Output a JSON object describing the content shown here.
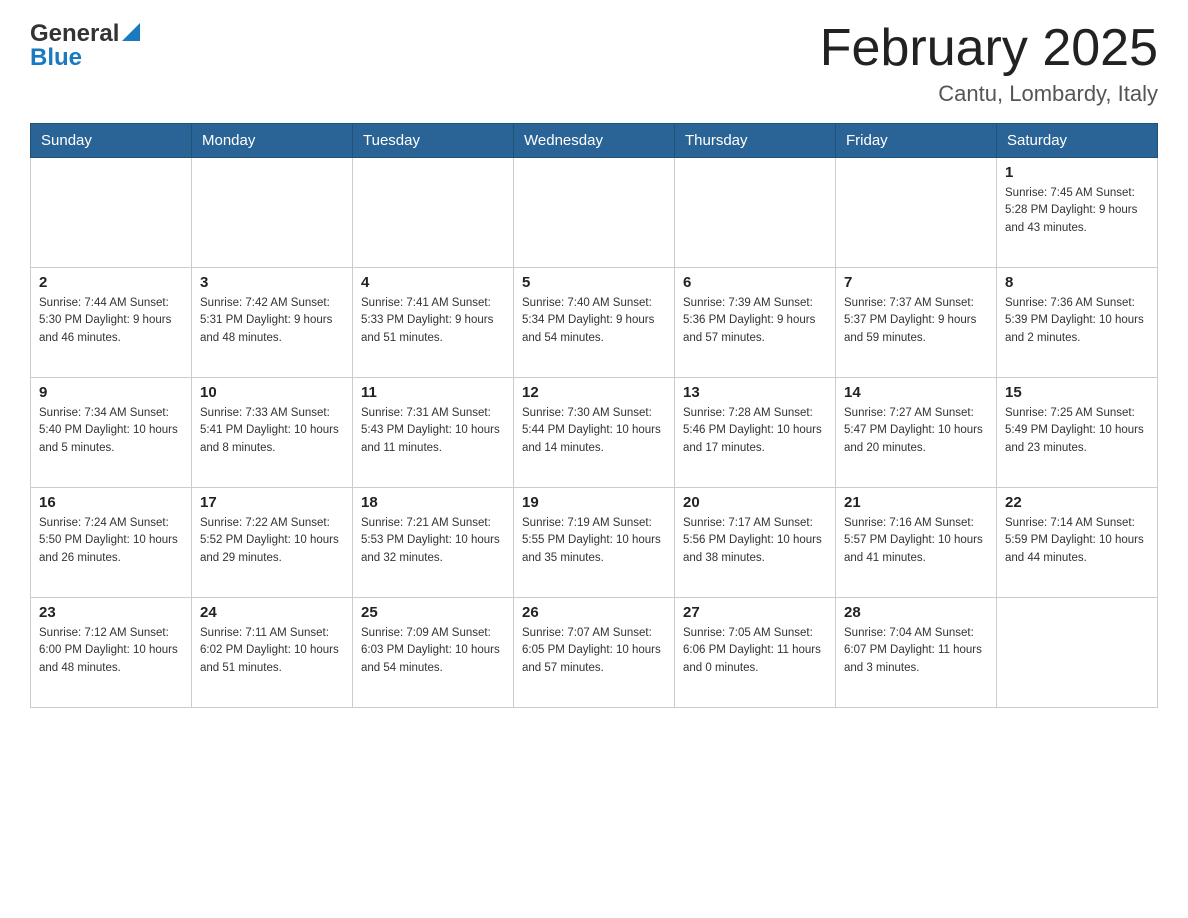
{
  "header": {
    "logo_general": "General",
    "logo_blue": "Blue",
    "month_title": "February 2025",
    "location": "Cantu, Lombardy, Italy"
  },
  "weekdays": [
    "Sunday",
    "Monday",
    "Tuesday",
    "Wednesday",
    "Thursday",
    "Friday",
    "Saturday"
  ],
  "weeks": [
    {
      "days": [
        {
          "num": "",
          "info": ""
        },
        {
          "num": "",
          "info": ""
        },
        {
          "num": "",
          "info": ""
        },
        {
          "num": "",
          "info": ""
        },
        {
          "num": "",
          "info": ""
        },
        {
          "num": "",
          "info": ""
        },
        {
          "num": "1",
          "info": "Sunrise: 7:45 AM\nSunset: 5:28 PM\nDaylight: 9 hours\nand 43 minutes."
        }
      ]
    },
    {
      "days": [
        {
          "num": "2",
          "info": "Sunrise: 7:44 AM\nSunset: 5:30 PM\nDaylight: 9 hours\nand 46 minutes."
        },
        {
          "num": "3",
          "info": "Sunrise: 7:42 AM\nSunset: 5:31 PM\nDaylight: 9 hours\nand 48 minutes."
        },
        {
          "num": "4",
          "info": "Sunrise: 7:41 AM\nSunset: 5:33 PM\nDaylight: 9 hours\nand 51 minutes."
        },
        {
          "num": "5",
          "info": "Sunrise: 7:40 AM\nSunset: 5:34 PM\nDaylight: 9 hours\nand 54 minutes."
        },
        {
          "num": "6",
          "info": "Sunrise: 7:39 AM\nSunset: 5:36 PM\nDaylight: 9 hours\nand 57 minutes."
        },
        {
          "num": "7",
          "info": "Sunrise: 7:37 AM\nSunset: 5:37 PM\nDaylight: 9 hours\nand 59 minutes."
        },
        {
          "num": "8",
          "info": "Sunrise: 7:36 AM\nSunset: 5:39 PM\nDaylight: 10 hours\nand 2 minutes."
        }
      ]
    },
    {
      "days": [
        {
          "num": "9",
          "info": "Sunrise: 7:34 AM\nSunset: 5:40 PM\nDaylight: 10 hours\nand 5 minutes."
        },
        {
          "num": "10",
          "info": "Sunrise: 7:33 AM\nSunset: 5:41 PM\nDaylight: 10 hours\nand 8 minutes."
        },
        {
          "num": "11",
          "info": "Sunrise: 7:31 AM\nSunset: 5:43 PM\nDaylight: 10 hours\nand 11 minutes."
        },
        {
          "num": "12",
          "info": "Sunrise: 7:30 AM\nSunset: 5:44 PM\nDaylight: 10 hours\nand 14 minutes."
        },
        {
          "num": "13",
          "info": "Sunrise: 7:28 AM\nSunset: 5:46 PM\nDaylight: 10 hours\nand 17 minutes."
        },
        {
          "num": "14",
          "info": "Sunrise: 7:27 AM\nSunset: 5:47 PM\nDaylight: 10 hours\nand 20 minutes."
        },
        {
          "num": "15",
          "info": "Sunrise: 7:25 AM\nSunset: 5:49 PM\nDaylight: 10 hours\nand 23 minutes."
        }
      ]
    },
    {
      "days": [
        {
          "num": "16",
          "info": "Sunrise: 7:24 AM\nSunset: 5:50 PM\nDaylight: 10 hours\nand 26 minutes."
        },
        {
          "num": "17",
          "info": "Sunrise: 7:22 AM\nSunset: 5:52 PM\nDaylight: 10 hours\nand 29 minutes."
        },
        {
          "num": "18",
          "info": "Sunrise: 7:21 AM\nSunset: 5:53 PM\nDaylight: 10 hours\nand 32 minutes."
        },
        {
          "num": "19",
          "info": "Sunrise: 7:19 AM\nSunset: 5:55 PM\nDaylight: 10 hours\nand 35 minutes."
        },
        {
          "num": "20",
          "info": "Sunrise: 7:17 AM\nSunset: 5:56 PM\nDaylight: 10 hours\nand 38 minutes."
        },
        {
          "num": "21",
          "info": "Sunrise: 7:16 AM\nSunset: 5:57 PM\nDaylight: 10 hours\nand 41 minutes."
        },
        {
          "num": "22",
          "info": "Sunrise: 7:14 AM\nSunset: 5:59 PM\nDaylight: 10 hours\nand 44 minutes."
        }
      ]
    },
    {
      "days": [
        {
          "num": "23",
          "info": "Sunrise: 7:12 AM\nSunset: 6:00 PM\nDaylight: 10 hours\nand 48 minutes."
        },
        {
          "num": "24",
          "info": "Sunrise: 7:11 AM\nSunset: 6:02 PM\nDaylight: 10 hours\nand 51 minutes."
        },
        {
          "num": "25",
          "info": "Sunrise: 7:09 AM\nSunset: 6:03 PM\nDaylight: 10 hours\nand 54 minutes."
        },
        {
          "num": "26",
          "info": "Sunrise: 7:07 AM\nSunset: 6:05 PM\nDaylight: 10 hours\nand 57 minutes."
        },
        {
          "num": "27",
          "info": "Sunrise: 7:05 AM\nSunset: 6:06 PM\nDaylight: 11 hours\nand 0 minutes."
        },
        {
          "num": "28",
          "info": "Sunrise: 7:04 AM\nSunset: 6:07 PM\nDaylight: 11 hours\nand 3 minutes."
        },
        {
          "num": "",
          "info": ""
        }
      ]
    }
  ]
}
